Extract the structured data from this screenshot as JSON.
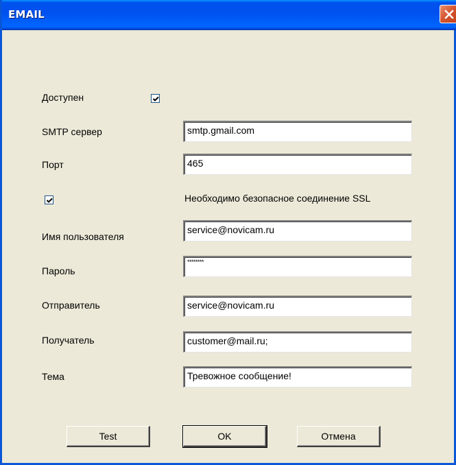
{
  "window": {
    "title": "EMAIL"
  },
  "form": {
    "enabled": {
      "label": "Доступен",
      "checked": true
    },
    "smtp_server": {
      "label": "SMTP сервер",
      "value": "smtp.gmail.com"
    },
    "port": {
      "label": "Порт",
      "value": "465"
    },
    "ssl": {
      "label": "Необходимо безопасное соединение SSL",
      "checked": true
    },
    "username": {
      "label": "Имя пользователя",
      "value": "service@novicam.ru"
    },
    "password": {
      "label": "Пароль",
      "value": "********"
    },
    "sender": {
      "label": "Отправитель",
      "value": "service@novicam.ru"
    },
    "recipient": {
      "label": "Получатель",
      "value": "customer@mail.ru;"
    },
    "subject": {
      "label": "Тема",
      "value": "Тревожное сообщение!"
    }
  },
  "buttons": {
    "test": "Test",
    "ok": "OK",
    "cancel": "Отмена"
  },
  "colors": {
    "titlebar": "#0053ee",
    "close": "#d3532d",
    "dialog_bg": "#ece9d8"
  }
}
